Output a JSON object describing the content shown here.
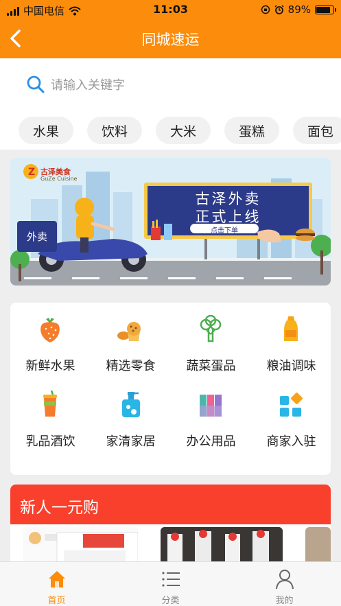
{
  "status_bar": {
    "carrier": "中国电信",
    "time": "11:03",
    "battery": "89%",
    "battery_level": 0.89
  },
  "nav": {
    "title": "同城速运",
    "back_icon": "chevron-left-icon"
  },
  "search": {
    "placeholder": "请输入关键字",
    "icon": "search-icon"
  },
  "categories": [
    "水果",
    "饮料",
    "大米",
    "蛋糕",
    "面包"
  ],
  "banner": {
    "brand_cn": "古泽美食",
    "brand_en": "GuZe Cuisine",
    "sign_line1": "古泽外卖",
    "sign_line2": "正式上线",
    "sign_button": "点击下单",
    "scooter_box": "外卖"
  },
  "grid": [
    {
      "label": "新鲜水果",
      "icon": "strawberry-icon"
    },
    {
      "label": "精选零食",
      "icon": "snacks-icon"
    },
    {
      "label": "蔬菜蛋品",
      "icon": "broccoli-icon"
    },
    {
      "label": "粮油调味",
      "icon": "oil-bottle-icon"
    },
    {
      "label": "乳品酒饮",
      "icon": "drink-cup-icon"
    },
    {
      "label": "家清家居",
      "icon": "soap-dispenser-icon"
    },
    {
      "label": "办公用品",
      "icon": "office-supplies-icon"
    },
    {
      "label": "商家入驻",
      "icon": "merchant-apps-icon"
    }
  ],
  "promo": {
    "title": "新人一元购"
  },
  "tabs": [
    {
      "label": "首页",
      "icon": "home-icon",
      "active": true
    },
    {
      "label": "分类",
      "icon": "list-icon",
      "active": false
    },
    {
      "label": "我的",
      "icon": "user-icon",
      "active": false
    }
  ],
  "colors": {
    "primary": "#fb8c0c",
    "promo_red": "#f8402c",
    "banner_sign": "#2c3a8a"
  }
}
